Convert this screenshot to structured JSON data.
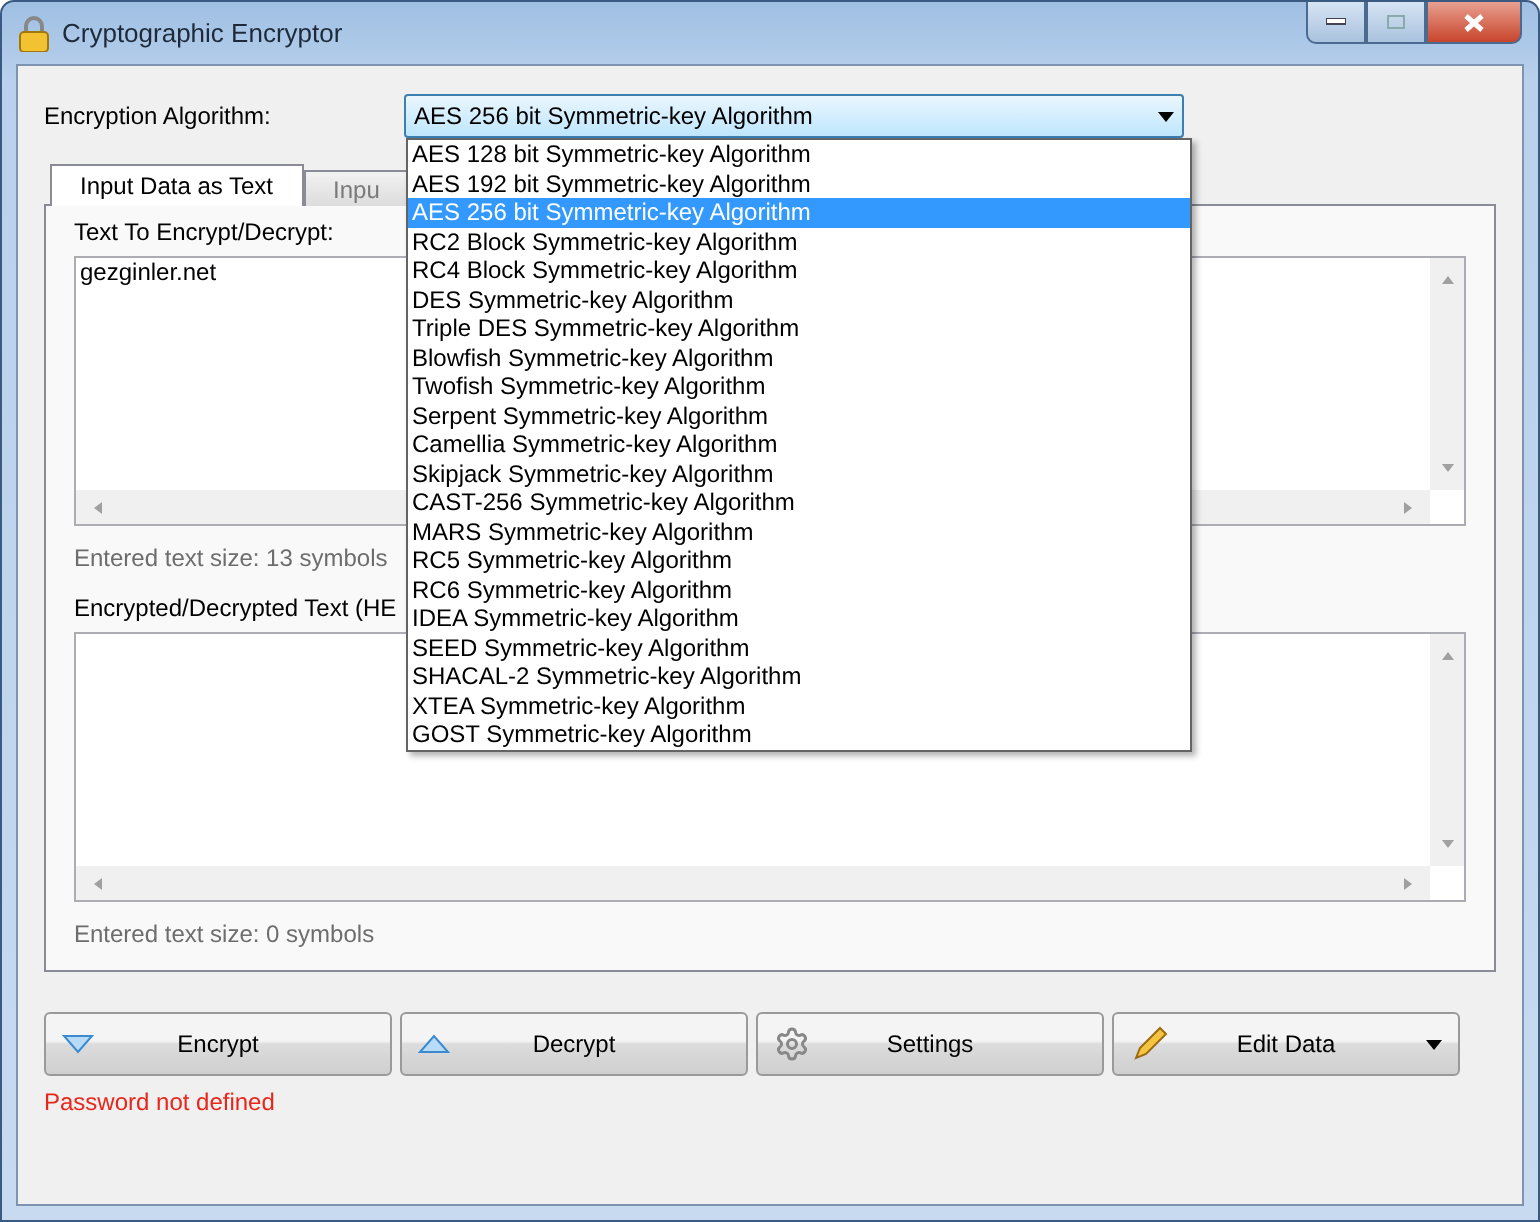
{
  "window": {
    "title": "Cryptographic Encryptor"
  },
  "algorithm": {
    "label": "Encryption Algorithm:",
    "value": "AES 256 bit Symmetric-key Algorithm",
    "expanded": true,
    "options": [
      {
        "label": "AES 128 bit Symmetric-key Algorithm",
        "selected": false
      },
      {
        "label": "AES 192 bit Symmetric-key Algorithm",
        "selected": false
      },
      {
        "label": "AES 256 bit Symmetric-key Algorithm",
        "selected": true
      },
      {
        "label": "RC2 Block Symmetric-key Algorithm",
        "selected": false
      },
      {
        "label": "RC4 Block Symmetric-key Algorithm",
        "selected": false
      },
      {
        "label": "DES Symmetric-key Algorithm",
        "selected": false
      },
      {
        "label": "Triple DES Symmetric-key Algorithm",
        "selected": false
      },
      {
        "label": "Blowfish Symmetric-key Algorithm",
        "selected": false
      },
      {
        "label": "Twofish Symmetric-key Algorithm",
        "selected": false
      },
      {
        "label": "Serpent Symmetric-key Algorithm",
        "selected": false
      },
      {
        "label": "Camellia Symmetric-key Algorithm",
        "selected": false
      },
      {
        "label": "Skipjack Symmetric-key Algorithm",
        "selected": false
      },
      {
        "label": "CAST-256 Symmetric-key Algorithm",
        "selected": false
      },
      {
        "label": "MARS Symmetric-key Algorithm",
        "selected": false
      },
      {
        "label": "RC5 Symmetric-key Algorithm",
        "selected": false
      },
      {
        "label": "RC6 Symmetric-key Algorithm",
        "selected": false
      },
      {
        "label": "IDEA Symmetric-key Algorithm",
        "selected": false
      },
      {
        "label": "SEED Symmetric-key Algorithm",
        "selected": false
      },
      {
        "label": "SHACAL-2 Symmetric-key Algorithm",
        "selected": false
      },
      {
        "label": "XTEA Symmetric-key Algorithm",
        "selected": false
      },
      {
        "label": "GOST Symmetric-key Algorithm",
        "selected": false
      }
    ]
  },
  "tabs": [
    {
      "label": "Input Data as Text",
      "selected": true
    },
    {
      "label": "Inpu",
      "selected": false
    }
  ],
  "input": {
    "label": "Text To Encrypt/Decrypt:",
    "value": "gezginler.net",
    "size": "Entered text size: 13 symbols"
  },
  "output": {
    "label": "Encrypted/Decrypted Text (HE",
    "size": "Entered text size: 0 symbols"
  },
  "buttons": [
    {
      "kind": "encrypt",
      "label": "Encrypt"
    },
    {
      "kind": "decrypt",
      "label": "Decrypt"
    },
    {
      "kind": "settings",
      "label": "Settings"
    },
    {
      "kind": "edit",
      "label": "Edit Data"
    }
  ],
  "status": "Password not defined"
}
